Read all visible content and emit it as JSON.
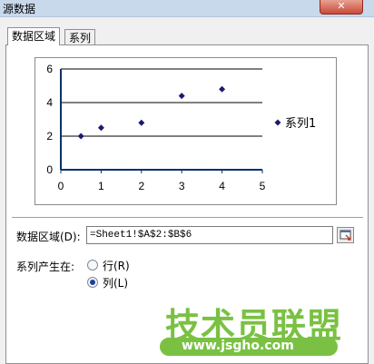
{
  "window": {
    "title": "源数据",
    "close_glyph": "✕"
  },
  "tabs": [
    {
      "label": "数据区域",
      "active": true
    },
    {
      "label": "系列",
      "active": false
    }
  ],
  "chart_data": {
    "type": "scatter",
    "series": [
      {
        "name": "系列1",
        "points": [
          [
            0.5,
            2.0
          ],
          [
            1.0,
            2.5
          ],
          [
            2.0,
            2.8
          ],
          [
            3.0,
            4.4
          ],
          [
            4.0,
            4.8
          ]
        ],
        "color": "#1a1a6e"
      }
    ],
    "x_ticks": [
      "0",
      "1",
      "2",
      "3",
      "4",
      "5"
    ],
    "y_ticks": [
      "0",
      "2",
      "4",
      "6"
    ],
    "xlim": [
      0,
      5
    ],
    "ylim": [
      0,
      6
    ],
    "grid": "horizontal",
    "legend_position": "right",
    "plot_background": "#ffffff",
    "axis_color": "#003366"
  },
  "form": {
    "range_label": "数据区域(D):",
    "range_value": "=Sheet1!$A$2:$B$6",
    "series_in_label": "系列产生在:",
    "radio_rows": "行(R)",
    "radio_cols": "列(L)",
    "selected": "cols"
  },
  "watermark": {
    "main": "技术员联盟",
    "url": "www.jsgho.com",
    "color": "#7ac143"
  }
}
